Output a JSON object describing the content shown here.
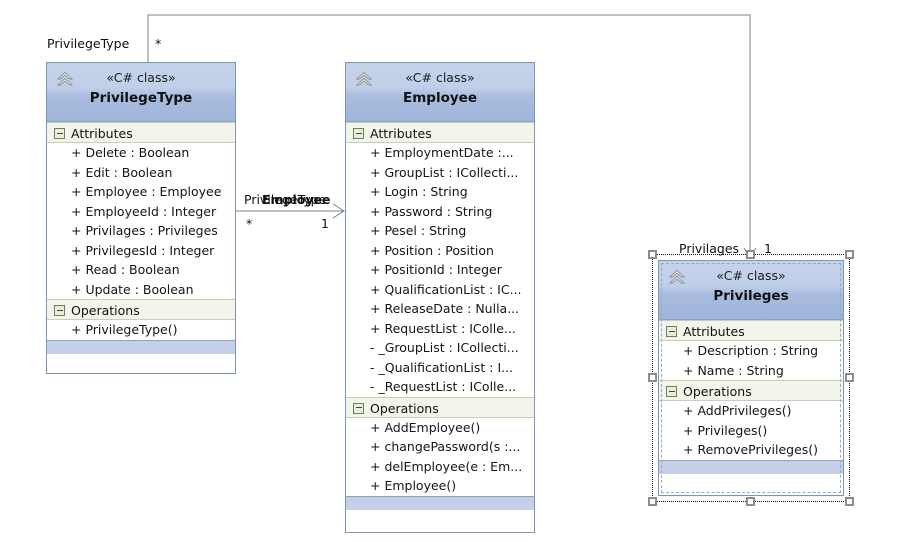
{
  "diagram": {
    "type": "uml-class-diagram",
    "background": "#ffffff",
    "header_gradient_top": "#c5d2ea",
    "header_gradient_bottom": "#9fb5da",
    "border_color": "#7a96b8",
    "section_header_bg": "#f3f5ea",
    "footer_strip_color": "#c3d0e7"
  },
  "classes": [
    {
      "id": "privilegetype",
      "stereotype": "«C# class»",
      "name": "PrivilegeType",
      "selected": false,
      "icon": "double-chevron-up-icon",
      "sections": [
        {
          "label": "Attributes",
          "members": [
            "+ Delete : Boolean",
            "+ Edit : Boolean",
            "+ Employee : Employee",
            "+ EmployeeId : Integer",
            "+ Privilages : Privileges",
            "+ PrivilegesId : Integer",
            "+ Read : Boolean",
            "+ Update : Boolean"
          ]
        },
        {
          "label": "Operations",
          "members": [
            "+ PrivilegeType()"
          ]
        }
      ]
    },
    {
      "id": "employee",
      "stereotype": "«C# class»",
      "name": "Employee",
      "selected": false,
      "icon": "double-chevron-up-icon",
      "sections": [
        {
          "label": "Attributes",
          "members": [
            "+ EmploymentDate :...",
            "+ GroupList : ICollecti...",
            "+ Login : String",
            "+ Password : String",
            "+ Pesel : String",
            "+ Position : Position",
            "+ PositionId : Integer",
            "+ QualificationList : IC...",
            "+ ReleaseDate : Nulla...",
            "+ RequestList : IColle...",
            "-  _GroupList : ICollecti...",
            "-  _QualificationList : I...",
            "-  _RequestList : IColle..."
          ]
        },
        {
          "label": "Operations",
          "members": [
            "+ AddEmployee()",
            "+ changePassword(s :...",
            "+ delEmployee(e : Em...",
            "+ Employee()"
          ]
        }
      ]
    },
    {
      "id": "privileges",
      "stereotype": "«C# class»",
      "name": "Privileges",
      "selected": true,
      "icon": "double-chevron-up-icon",
      "sections": [
        {
          "label": "Attributes",
          "members": [
            "+ Description : String",
            "+ Name : String"
          ]
        },
        {
          "label": "Operations",
          "members": [
            "+ AddPrivileges()",
            "+ Privileges()",
            "+ RemovePrivileges()"
          ]
        }
      ]
    }
  ],
  "associations": [
    {
      "id": "privilegetype-self",
      "role_label": "PrivilegeType",
      "multiplicity": "*"
    },
    {
      "id": "privilegetype-employee-role",
      "role_label": "PrivilegeType",
      "multiplicity": "*"
    },
    {
      "id": "employee-target",
      "role_label": "Employee",
      "multiplicity": "1"
    },
    {
      "id": "privileges-target",
      "role_label": "Privilages",
      "multiplicity": "1"
    }
  ]
}
